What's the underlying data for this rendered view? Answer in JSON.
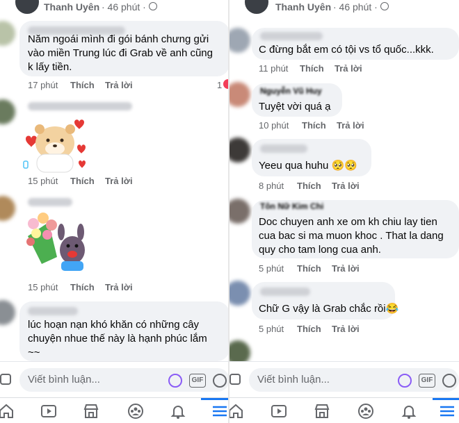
{
  "left": {
    "post_author": "Thanh Uyên",
    "post_time": "· 46 phút ·",
    "comments": [
      {
        "lines": [
          "Năm ngoái mình đi gói bánh chưng gửi",
          "vào miền Trung lúc đi Grab về anh cũng",
          "k lấy tiền."
        ],
        "time": "17 phút",
        "like": "Thích",
        "reply": "Trả lời",
        "react_count": "1"
      },
      {
        "sticker": "bear-heart-sticker",
        "time": "15 phút",
        "like": "Thích",
        "reply": "Trả lời"
      },
      {
        "sticker": "flower-bouquet-sticker",
        "time": "15 phút",
        "like": "Thích",
        "reply": "Trả lời"
      },
      {
        "lines": [
          "lúc hoạn nạn khó khăn có những cây",
          "chuyện nhue thế này là hạnh phúc lắm",
          "~~"
        ]
      }
    ],
    "comment_placeholder": "Viết bình luận...",
    "gif_label": "GIF"
  },
  "right": {
    "post_author": "Thanh Uyên",
    "post_time": "· 46 phút ·",
    "comments": [
      {
        "lines": [
          "C đừng bắt em có tội vs tổ quốc...kkk."
        ],
        "time": "11 phút",
        "like": "Thích",
        "reply": "Trả lời"
      },
      {
        "name": "Nguyễn Vũ Huy",
        "lines": [
          "Tuyệt vời quá ạ"
        ],
        "time": "10 phút",
        "like": "Thích",
        "reply": "Trả lời"
      },
      {
        "lines": [
          "Yeeu qua huhu 🥺🥺"
        ],
        "time": "8 phút",
        "like": "Thích",
        "reply": "Trả lời"
      },
      {
        "name": "Tôn Nữ Kim Chi",
        "lines": [
          "Doc chuyen anh xe om kh chiu lay tien",
          "cua bac si ma muon khoc . That la dang",
          "quy cho tam long cua anh."
        ],
        "time": "5 phút",
        "like": "Thích",
        "reply": "Trả lời"
      },
      {
        "lines": [
          "Chữ G vậy là Grab chắc rồi😂"
        ],
        "time": "5 phút",
        "like": "Thích",
        "reply": "Trả lời"
      }
    ],
    "comment_placeholder": "Viết bình luận...",
    "gif_label": "GIF"
  },
  "nav_icons": [
    "home-icon",
    "watch-icon",
    "marketplace-icon",
    "groups-icon",
    "notifications-icon",
    "menu-icon"
  ],
  "colors": {
    "bubble": "#f0f2f5",
    "meta": "#65676b",
    "accent": "#1877f2"
  }
}
